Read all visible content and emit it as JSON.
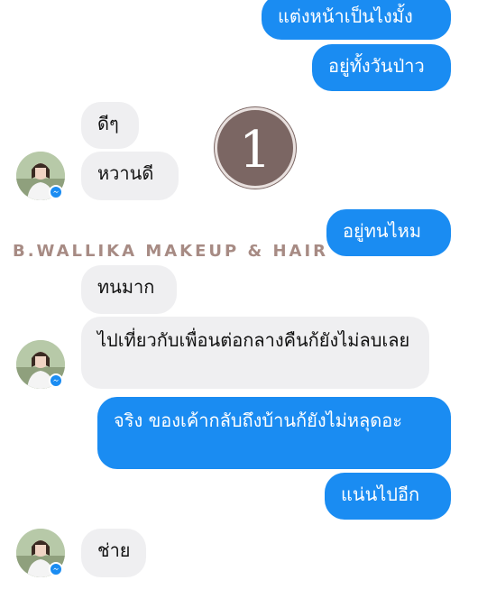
{
  "messages": [
    {
      "text": "แต่งหน้าเป็นไงมั้ง",
      "direction": "outgoing"
    },
    {
      "text": "อยู่ทั้งวันป่าว",
      "direction": "outgoing"
    },
    {
      "text": "ดีๆ",
      "direction": "incoming"
    },
    {
      "text": "หวานดี",
      "direction": "incoming"
    },
    {
      "text": "อยู่ทนไหม",
      "direction": "outgoing"
    },
    {
      "text": "ทนมาก",
      "direction": "incoming"
    },
    {
      "text": "ไปเที่ยวกับเพื่อนต่อกลางคืนก้ยังไม่ลบเลย",
      "direction": "incoming"
    },
    {
      "text": "จริง ของเค้ากลับถึงบ้านก้ยังไม่หลุดอะ",
      "direction": "outgoing"
    },
    {
      "text": "แน่นไปอีก",
      "direction": "outgoing"
    },
    {
      "text": "ช่าย",
      "direction": "incoming"
    }
  ],
  "watermark": "B.WALLIKA MAKEUP & HAIR",
  "step_number": "1",
  "colors": {
    "outgoing_bubble": "#1a8cf2",
    "incoming_bubble": "#efeff1",
    "watermark": "#a78b84",
    "step_badge": "#7b6663"
  },
  "icons": {
    "avatar": "profile-avatar",
    "badge": "messenger-icon"
  }
}
